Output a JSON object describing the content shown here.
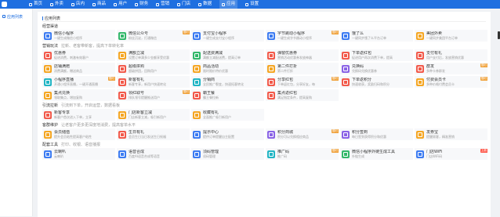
{
  "colors": {
    "blue": "#3d7cf2",
    "orange": "#f5a623",
    "green": "#33b76a",
    "red": "#f25a4b",
    "purple": "#8a63e6",
    "teal": "#22b5c4",
    "badge_orange": "#f0a23b",
    "badge_red": "#ff5a4c"
  },
  "topnav": {
    "items": [
      {
        "label": "首页",
        "icon": "home-icon"
      },
      {
        "label": "外卖",
        "icon": "bike-icon"
      },
      {
        "label": "店内",
        "icon": "store-icon"
      },
      {
        "label": "商品",
        "icon": "goods-icon"
      },
      {
        "label": "用户",
        "icon": "user-icon"
      },
      {
        "label": "财务",
        "icon": "wallet-icon"
      },
      {
        "label": "营销",
        "icon": "megaphone-icon"
      },
      {
        "label": "门店",
        "icon": "shop-icon"
      },
      {
        "label": "数据",
        "icon": "chart-icon"
      },
      {
        "label": "应用",
        "icon": "apps-icon"
      },
      {
        "label": "设置",
        "icon": "gear-icon"
      }
    ]
  },
  "sidebar": {
    "items": [
      {
        "label": "应用列表",
        "icon": "grid-icon"
      }
    ]
  },
  "breadcrumb": "应用列表",
  "sections": [
    {
      "title": "经营渠道",
      "desc": "",
      "cards": [
        {
          "name": "微信小程序",
          "sub": "一键生成微信小程序",
          "color": "#3d7cf2",
          "badge": ""
        },
        {
          "name": "微信公众号",
          "sub": "粉丝沉淀，打通微信",
          "color": "#33b76a",
          "badge": "限时"
        },
        {
          "name": "支付宝小程序",
          "sub": "一键生成支付宝小程序",
          "color": "#3d7cf2",
          "badge": ""
        },
        {
          "name": "字节跳动小程序",
          "sub": "一键生成字节跳动小程序",
          "color": "#3d7cf2",
          "badge": "限时"
        },
        {
          "name": "饿了么",
          "sub": "一键同步饿了么平台订单",
          "color": "#3d7cf2",
          "badge": ""
        },
        {
          "name": "美团外卖",
          "sub": "一键同步美团平台订单",
          "color": "#f5a623",
          "badge": ""
        }
      ]
    },
    {
      "title": "营销玩法",
      "desc": "拉新、老客带新客，提高下单转化率",
      "cards": [
        {
          "name": "优惠券",
          "sub": "促进消费，刺激有效客户",
          "color": "#f25a4b",
          "badge": ""
        },
        {
          "name": "满额立减",
          "sub": "设置订单满多少金额享受优惠",
          "color": "#f5a623",
          "badge": ""
        },
        {
          "name": "配送费满减",
          "sub": "满额立减配送费，提高订单",
          "color": "#33b76a",
          "badge": ""
        },
        {
          "name": "弹窗优惠券",
          "sub": "营销活动优惠券发放神器",
          "color": "#f25a4b",
          "badge": ""
        },
        {
          "name": "下单返红包",
          "sub": "促进用户再次消费下单，提高",
          "color": "#f25a4b",
          "badge": ""
        },
        {
          "name": "支付有礼",
          "sub": "用户支付后，发放营销优惠",
          "color": "#f25a4b",
          "badge": ""
        },
        {
          "name": "店铺满赠",
          "sub": "消费满额，赠送商品",
          "color": "#f5a623",
          "badge": ""
        },
        {
          "name": "超级拼购",
          "sub": "超级拼团，回购用户",
          "color": "#f25a4b",
          "badge": ""
        },
        {
          "name": "商品活动",
          "sub": "限时限价特价优惠",
          "color": "#f5a623",
          "badge": ""
        },
        {
          "name": "第二件打折",
          "sub": "第二件打折",
          "color": "#f5a623",
          "badge": ""
        },
        {
          "name": "兑换码",
          "sub": "兑换码兑换优惠券",
          "color": "#8a63e6",
          "badge": ""
        },
        {
          "name": "群发",
          "sub": "多种卡券群发",
          "color": "#f25a4b",
          "badge": "限时"
        },
        {
          "name": "小程序直播",
          "sub": "开通小程序直播，一键开通直播",
          "color": "#22b5c4",
          "badge": "限时"
        },
        {
          "name": "新客有礼",
          "sub": "新客专享，新用户快速转化",
          "color": "#f25a4b",
          "badge": ""
        },
        {
          "name": "分销商",
          "sub": "全民推广裂变，快速拓客转化",
          "color": "#22b5c4",
          "badge": ""
        },
        {
          "name": "分享红包",
          "sub": "下单返红包，分享好友，每",
          "color": "#f25a4b",
          "badge": "限时"
        },
        {
          "name": "下单返积分",
          "sub": "快速收获，奖励扫码和积分",
          "color": "#f25a4b",
          "badge": ""
        },
        {
          "name": "付费会员卡",
          "sub": "多种价格付费会员卡",
          "color": "#f5a623",
          "badge": "限时"
        },
        {
          "name": "集点兑换",
          "sub": "领取集点，增加复购",
          "color": "#f5a623",
          "badge": ""
        },
        {
          "name": "领红取号",
          "sub": "排队领号提醒推送用户",
          "color": "#f25a4b",
          "badge": "限时"
        },
        {
          "name": "霸王餐",
          "sub": "霸王餐拉新",
          "color": "#f25a4b",
          "badge": ""
        },
        {
          "name": "集点返红包",
          "sub": "满足指定条件，提高复购",
          "color": "#f25a4b",
          "badge": ""
        }
      ]
    },
    {
      "title": "引流拉新",
      "desc": "引流到下单，开启运营，数据看板",
      "cards": [
        {
          "name": "新客专享",
          "sub": "新客户首次进入下单，立享",
          "color": "#f25a4b",
          "badge": ""
        },
        {
          "name": "门店新客立减",
          "sub": "门店新客立减，吸引新用户",
          "color": "#f5a623",
          "badge": ""
        },
        {
          "name": "收藏有礼",
          "sub": "全面推广吸引新用户",
          "color": "#f5a623",
          "badge": ""
        }
      ]
    },
    {
      "title": "客群维护",
      "desc": "让老客户更多更深度地消费，提高客单水平",
      "cards": [
        {
          "name": "会员储值",
          "sub": "提升会员粘性提高客户粘性",
          "color": "#f5a623",
          "badge": ""
        },
        {
          "name": "生日有礼",
          "sub": "会员生日当日发送生日祝福",
          "color": "#f25a4b",
          "badge": ""
        },
        {
          "name": "提示中心",
          "sub": "提供订单提醒自主配置",
          "color": "#3d7cf2",
          "badge": ""
        },
        {
          "name": "积分商城",
          "sub": "积分可以兑换相应商品",
          "color": "#8a63e6",
          "badge": "限时"
        },
        {
          "name": "积分签到",
          "sub": "每日签到获得积分和优惠",
          "color": "#8a63e6",
          "badge": ""
        },
        {
          "name": "发券宝",
          "sub": "提醒顾客，精准营销",
          "color": "#f5a623",
          "badge": ""
        }
      ]
    },
    {
      "title": "配套工具",
      "desc": "打印、收银、语音播报",
      "cards": [
        {
          "name": "云喇叭",
          "sub": "云喇叭",
          "color": "#3d7cf2",
          "badge": ""
        },
        {
          "name": "语音合成",
          "sub": "百度AI语音合成等语音",
          "color": "#3d7cf2",
          "badge": ""
        },
        {
          "name": "须码管理",
          "sub": "须码管理",
          "color": "#3d7cf2",
          "badge": ""
        },
        {
          "name": "推广码",
          "sub": "推广码",
          "color": "#22b5c4",
          "badge": "限时"
        },
        {
          "name": "微信小程序外链生成工具",
          "sub": "外链生成",
          "color": "#33b76a",
          "badge": ""
        },
        {
          "name": "门店WiFi",
          "sub": "门店WiFi码",
          "color": "#3d7cf2",
          "badge": "上新"
        }
      ]
    }
  ]
}
